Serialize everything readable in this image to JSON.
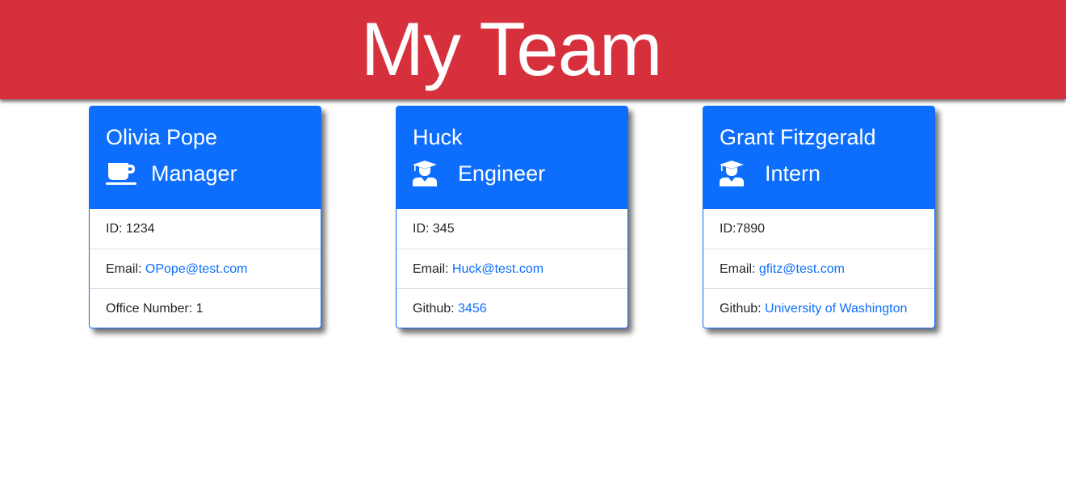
{
  "header": {
    "title": "My Team"
  },
  "team": [
    {
      "name": "Olivia Pope",
      "role": "Manager",
      "role_icon": "mug-icon",
      "id_text": "ID: 1234",
      "email_label": "Email: ",
      "email": "OPope@test.com",
      "extra_label": "Office Number: 1",
      "extra_link": ""
    },
    {
      "name": "Huck",
      "role": "Engineer",
      "role_icon": "graduate-icon",
      "id_text": "ID: 345",
      "email_label": "Email: ",
      "email": "Huck@test.com",
      "extra_label": "Github: ",
      "extra_link": "3456"
    },
    {
      "name": "Grant Fitzgerald",
      "role": "Intern",
      "role_icon": "graduate-icon",
      "id_text": "ID:7890",
      "email_label": "Email: ",
      "email": "gfitz@test.com",
      "extra_label": "Github: ",
      "extra_link": "University of Washington"
    }
  ],
  "colors": {
    "banner": "#d6303c",
    "card_header": "#0d6efd",
    "link": "#0d6efd"
  }
}
